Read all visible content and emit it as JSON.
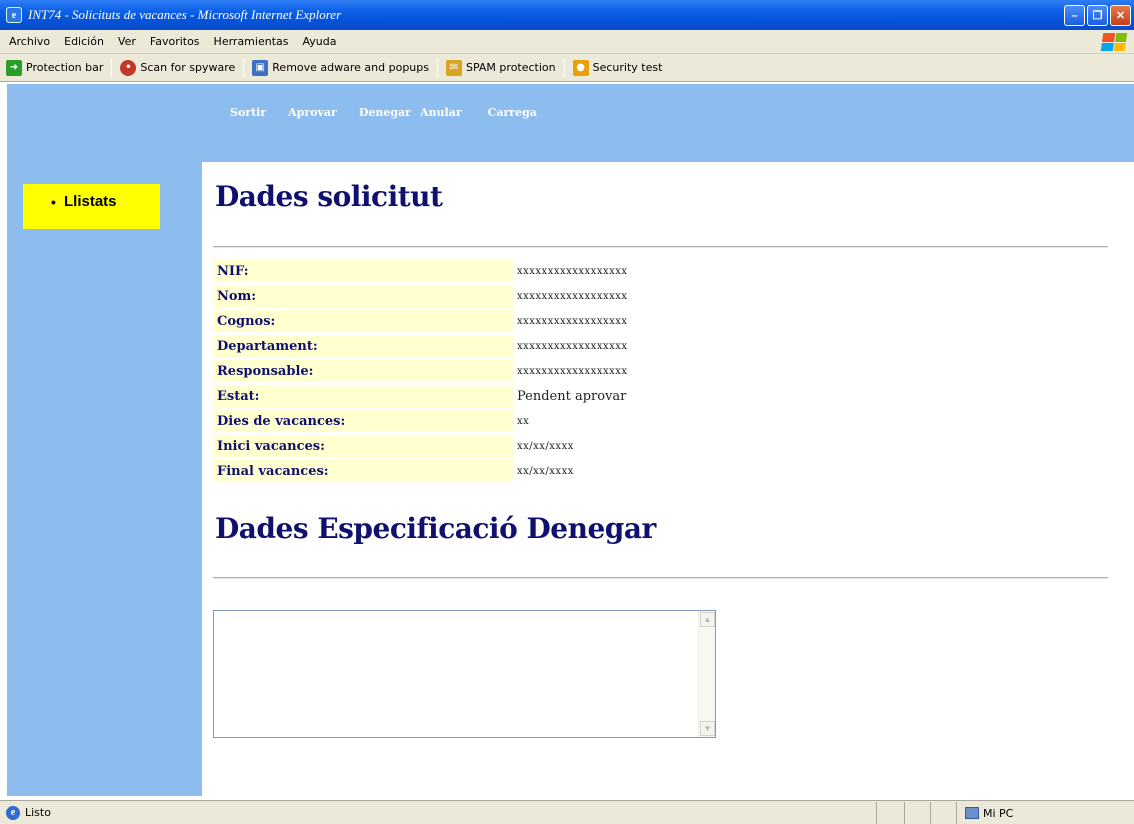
{
  "window": {
    "title": "INT74 - Solicituts de vacances - Microsoft Internet Explorer",
    "icon": "ie-icon"
  },
  "menu": [
    "Archivo",
    "Edición",
    "Ver",
    "Favoritos",
    "Herramientas",
    "Ayuda"
  ],
  "toolbar": {
    "items": [
      {
        "label": "Protection bar",
        "icon": "arrow-icon",
        "color": "#2a9d2a"
      },
      {
        "label": "Scan for spyware",
        "icon": "shield-icon",
        "color": "#c0392b"
      },
      {
        "label": "Remove adware and popups",
        "icon": "window-icon",
        "color": "#3c6fc4"
      },
      {
        "label": "SPAM protection",
        "icon": "envelope-icon",
        "color": "#d9a520"
      },
      {
        "label": "Security test",
        "icon": "lock-icon",
        "color": "#e8a00b"
      }
    ]
  },
  "nav": {
    "sortir": "Sortir",
    "aprovar": "Aprovar",
    "denegar": "Denegar",
    "anular": "Anular",
    "carrega": "Carrega"
  },
  "sidebar": {
    "items": [
      {
        "label": "Llistats"
      }
    ]
  },
  "request": {
    "heading": "Dades solicitut",
    "fields": [
      {
        "label": "NIF:",
        "value": "xxxxxxxxxxxxxxxxxx"
      },
      {
        "label": "Nom:",
        "value": "xxxxxxxxxxxxxxxxxx"
      },
      {
        "label": "Cognos:",
        "value": "xxxxxxxxxxxxxxxxxx"
      },
      {
        "label": "Departament:",
        "value": "xxxxxxxxxxxxxxxxxx"
      },
      {
        "label": "Responsable:",
        "value": "xxxxxxxxxxxxxxxxxx"
      },
      {
        "label": "Estat:",
        "value": "Pendent aprovar"
      },
      {
        "label": "Dies de vacances:",
        "value": "xx"
      },
      {
        "label": "Inici vacances:",
        "value": "xx/xx/xxxx"
      },
      {
        "label": "Final vacances:",
        "value": "xx/xx/xxxx"
      }
    ]
  },
  "deny": {
    "heading": "Dades Especificació Denegar",
    "text": ""
  },
  "status": {
    "text": "Listo",
    "zone": "Mi PC"
  },
  "colors": {
    "header_bg": "#8dbcee",
    "sidebar_highlight": "#ffff00",
    "heading": "#10106e",
    "label_bg": "#ffffd0"
  }
}
